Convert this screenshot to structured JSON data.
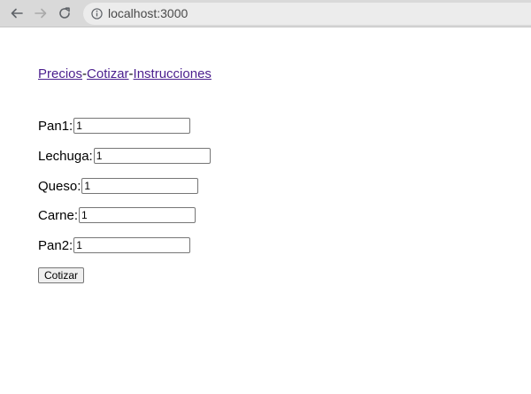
{
  "browser": {
    "url": "localhost:3000"
  },
  "nav": {
    "links": [
      "Precios",
      "Cotizar",
      "Instrucciones"
    ],
    "separator": "-"
  },
  "form": {
    "fields": [
      {
        "label": "Pan1:",
        "value": "1"
      },
      {
        "label": "Lechuga:",
        "value": "1"
      },
      {
        "label": "Queso:",
        "value": "1"
      },
      {
        "label": "Carne:",
        "value": "1"
      },
      {
        "label": "Pan2:",
        "value": "1"
      }
    ],
    "submit_label": "Cotizar"
  }
}
